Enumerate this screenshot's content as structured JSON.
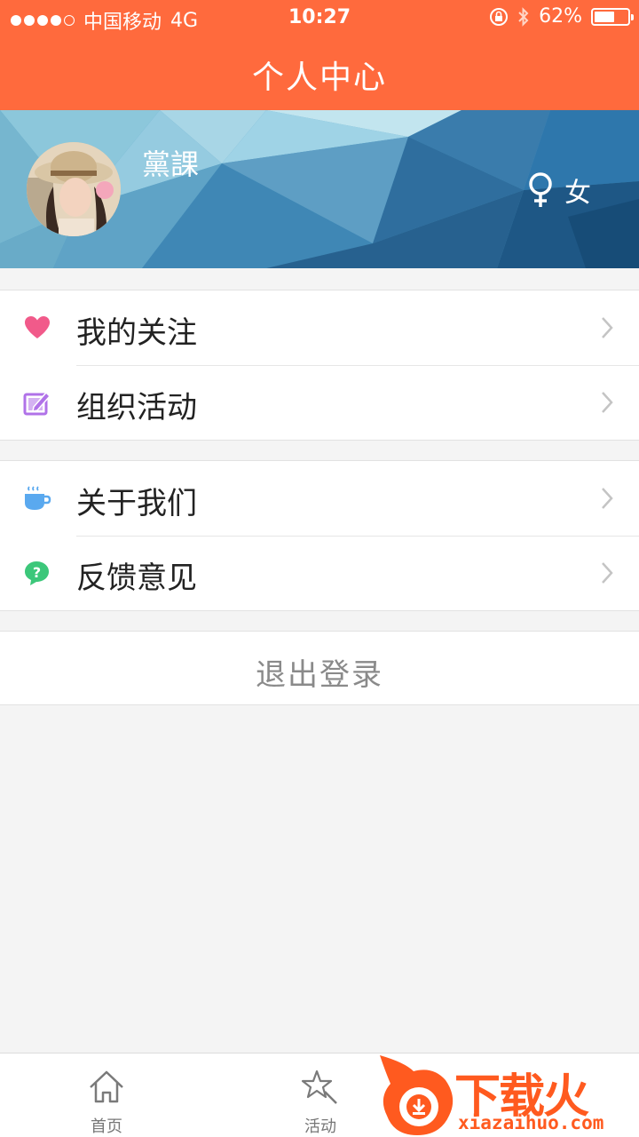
{
  "status_bar": {
    "carrier": "中国移动",
    "network": "4G",
    "time": "10:27",
    "battery": "62%",
    "battery_level": 0.62
  },
  "nav": {
    "title": "个人中心"
  },
  "profile": {
    "name": "黨課",
    "gender": "女"
  },
  "menu_groups": [
    {
      "items": [
        {
          "label": "我的关注",
          "icon": "heart-icon",
          "color": "#f15a8a"
        },
        {
          "label": "组织活动",
          "icon": "edit-icon",
          "color": "#b072e8"
        }
      ]
    },
    {
      "items": [
        {
          "label": "关于我们",
          "icon": "coffee-cup-icon",
          "color": "#5aa9ef"
        },
        {
          "label": "反馈意见",
          "icon": "question-bubble-icon",
          "color": "#3cc77a"
        }
      ]
    }
  ],
  "logout": {
    "label": "退出登录"
  },
  "tab_bar": {
    "tabs": [
      {
        "label": "首页",
        "icon": "home-icon"
      },
      {
        "label": "活动",
        "icon": "activity-star-icon"
      }
    ]
  },
  "watermark": {
    "brand": "下载火",
    "url": "xiazaihuo.com"
  },
  "colors": {
    "accent": "#ff6a3d",
    "background": "#f4f4f4"
  }
}
